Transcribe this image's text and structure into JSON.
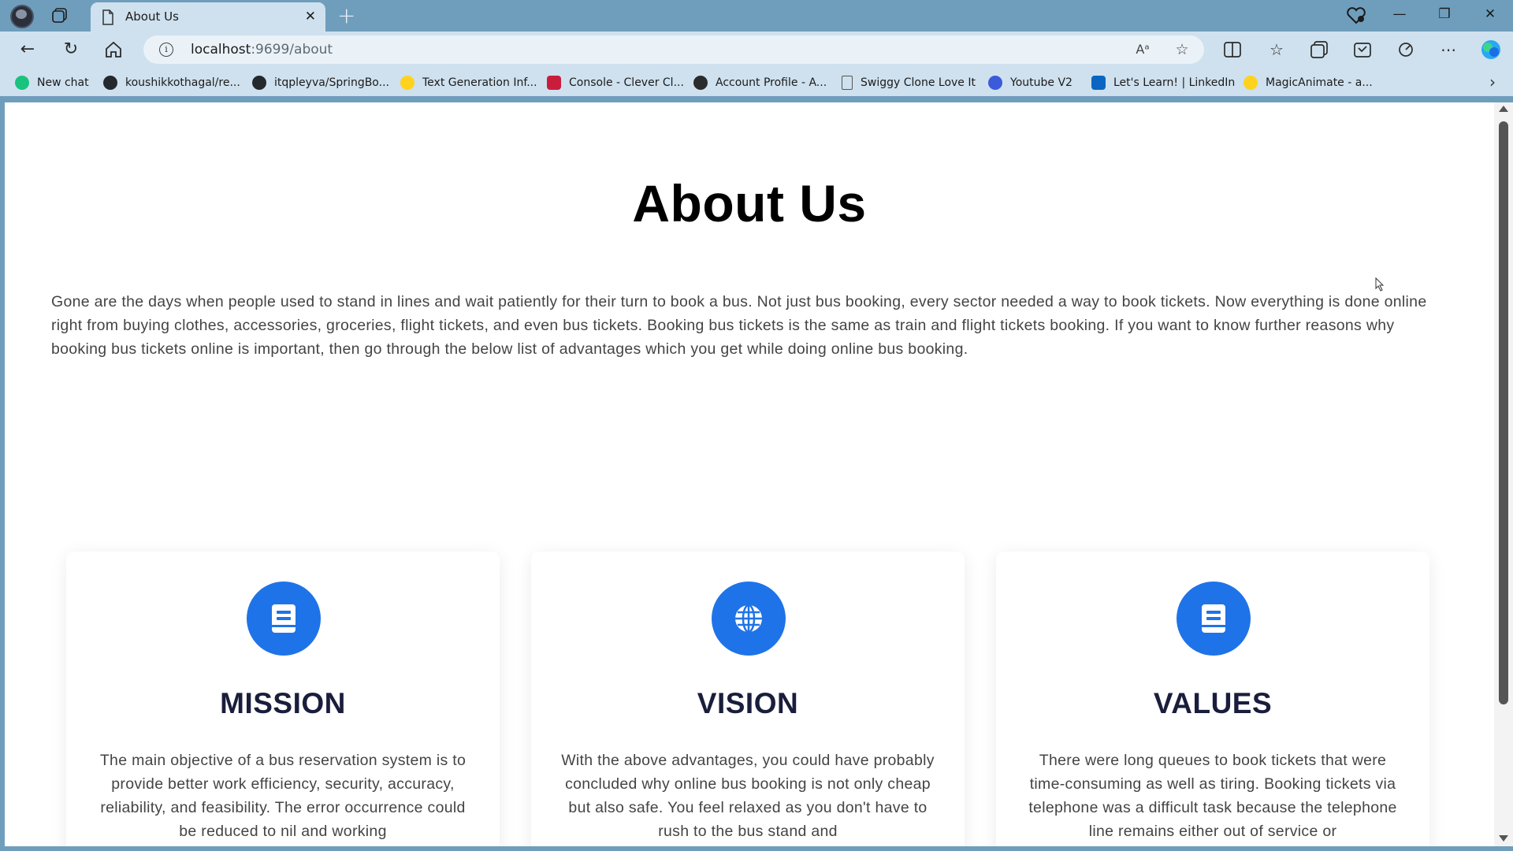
{
  "browser": {
    "tab": {
      "title": "About Us"
    },
    "address": {
      "host": "localhost",
      "path": ":9699/about"
    },
    "bookmarks": [
      {
        "label": "New chat",
        "icon": "chatgpt-icon",
        "color": "#19c37d"
      },
      {
        "label": "koushikkothagal/re...",
        "icon": "github-icon",
        "color": "#24292e"
      },
      {
        "label": "itqpleyva/SpringBo...",
        "icon": "github-icon",
        "color": "#24292e"
      },
      {
        "label": "Text Generation Inf...",
        "icon": "hugging-face-icon",
        "color": "#ffd21e"
      },
      {
        "label": "Console - Clever Cl...",
        "icon": "clever-cloud-icon",
        "color": "#c81e3c"
      },
      {
        "label": "Account Profile - A...",
        "icon": "account-icon",
        "color": "#2b2b2b"
      },
      {
        "label": "Swiggy Clone Love It",
        "icon": "page-icon",
        "color": "#555555"
      },
      {
        "label": "Youtube V2",
        "icon": "youtube-v2-icon",
        "color": "#3b5bdb"
      },
      {
        "label": "Let's Learn! | LinkedIn",
        "icon": "linkedin-icon",
        "color": "#0a66c2"
      },
      {
        "label": "MagicAnimate - a...",
        "icon": "hugging-face-icon",
        "color": "#ffd21e"
      }
    ]
  },
  "page": {
    "title": "About Us",
    "intro": "Gone are the days when people used to stand in lines and wait patiently for their turn to book a bus. Not just bus booking, every sector needed a way to book tickets. Now everything is done online right from buying clothes, accessories, groceries, flight tickets, and even bus tickets. Booking bus tickets is the same as train and flight tickets booking. If you want to know further reasons why booking bus tickets online is important, then go through the below list of advantages which you get while doing online bus booking.",
    "cards": [
      {
        "title": "MISSION",
        "icon": "book-icon",
        "text": "The main objective of a bus reservation system is to provide better work efficiency, security, accuracy, reliability, and feasibility. The error occurrence could be reduced to nil and working"
      },
      {
        "title": "VISION",
        "icon": "globe-icon",
        "text": "With the above advantages, you could have probably concluded why online bus booking is not only cheap but also safe. You feel relaxed as you don't have to rush to the bus stand and"
      },
      {
        "title": "VALUES",
        "icon": "book-icon",
        "text": "There were long queues to book tickets that were time-consuming as well as tiring. Booking tickets via telephone was a difficult task because the telephone line remains either out of service or"
      }
    ],
    "accent_color": "#1f73e8"
  }
}
